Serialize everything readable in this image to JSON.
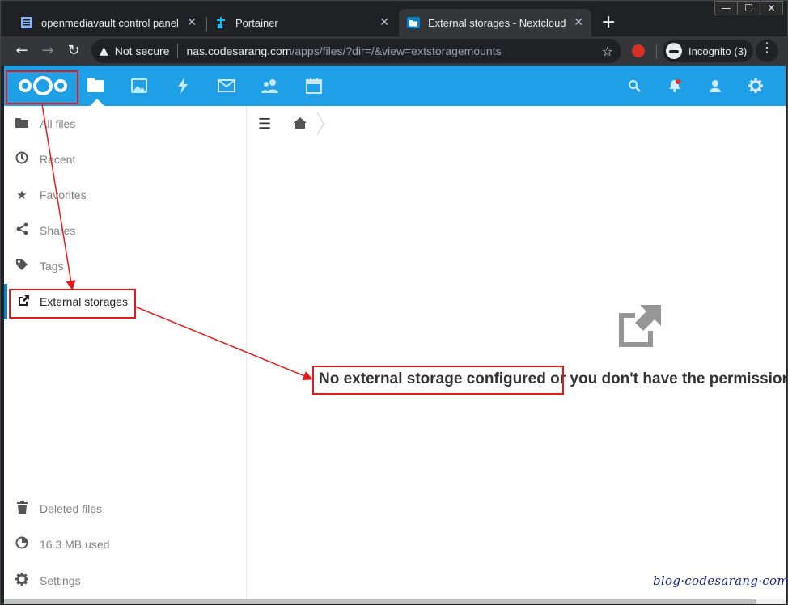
{
  "browser": {
    "tabs": [
      {
        "label": "openmediavault control panel - c",
        "icon": "document-icon",
        "active": false
      },
      {
        "label": "Portainer",
        "icon": "portainer-icon",
        "active": false
      },
      {
        "label": "External storages - Nextcloud",
        "icon": "folder-icon",
        "active": true
      }
    ],
    "close_glyph": "✕",
    "new_tab_glyph": "+",
    "window_controls": {
      "minimize": "—",
      "maximize": "☐",
      "close": "✕"
    },
    "omnibox": {
      "security_label": "Not secure",
      "host": "nas.codesarang.com",
      "path": "/apps/files/?dir=/&view=extstoragemounts"
    },
    "incognito_label": "Incognito (3)"
  },
  "nextcloud": {
    "header_apps": [
      "files",
      "photos",
      "activity",
      "mail",
      "contacts",
      "calendar"
    ],
    "header_right": [
      "search",
      "notifications",
      "contacts-menu",
      "settings"
    ],
    "sidebar": {
      "items": [
        {
          "label": "All files",
          "icon": "folder-icon"
        },
        {
          "label": "Recent",
          "icon": "clock-icon"
        },
        {
          "label": "Favorites",
          "icon": "star-icon"
        },
        {
          "label": "Shares",
          "icon": "share-icon"
        },
        {
          "label": "Tags",
          "icon": "tag-icon"
        },
        {
          "label": "External storages",
          "icon": "external-link-icon",
          "active": true
        }
      ],
      "bottom": [
        {
          "label": "Deleted files",
          "icon": "trash-icon"
        },
        {
          "label": "16.3 MB used",
          "icon": "pie-icon"
        },
        {
          "label": "Settings",
          "icon": "gear-icon"
        }
      ]
    },
    "empty_message_highlight": "No external storage configured",
    "empty_message_rest": " or you don't have the permission to configure them"
  },
  "watermark": "blog·codesarang·com",
  "colors": {
    "nextcloud_blue": "#1e9fe6",
    "annotation_red": "#e21b1b",
    "browser_dark": "#202124"
  }
}
